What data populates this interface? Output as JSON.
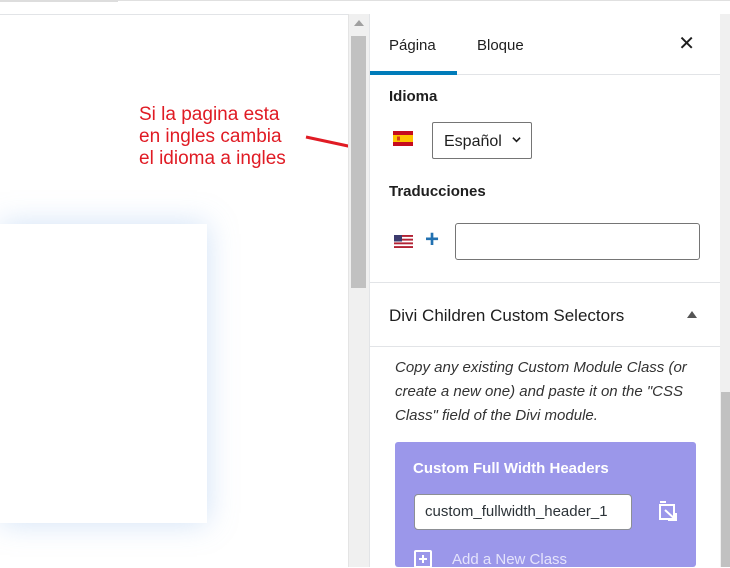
{
  "annotation": {
    "lines": [
      "Si la pagina esta",
      "en ingles cambia",
      "el idioma a ingles"
    ],
    "color": "#e01b24"
  },
  "tabs": [
    {
      "label": "Página",
      "active": true
    },
    {
      "label": "Bloque",
      "active": false
    }
  ],
  "close_icon": "close-icon",
  "language": {
    "label": "Idioma",
    "flag": "flag-spain-icon",
    "selected": "Español"
  },
  "translations": {
    "label": "Traducciones",
    "flag": "flag-usa-icon",
    "add_icon": "plus-icon",
    "input_value": ""
  },
  "custom_selectors": {
    "title": "Divi Children Custom Selectors",
    "description": "Copy any existing Custom Module Class (or create a new one) and paste it on the \"CSS Class\" field of the Divi module.",
    "card": {
      "title": "Custom Full Width Headers",
      "class_value": "custom_fullwidth_header_1",
      "add_label": "Add a New Class",
      "background": "#9b97ea"
    }
  },
  "colors": {
    "accent": "#007cba",
    "plus": "#2271b1"
  }
}
